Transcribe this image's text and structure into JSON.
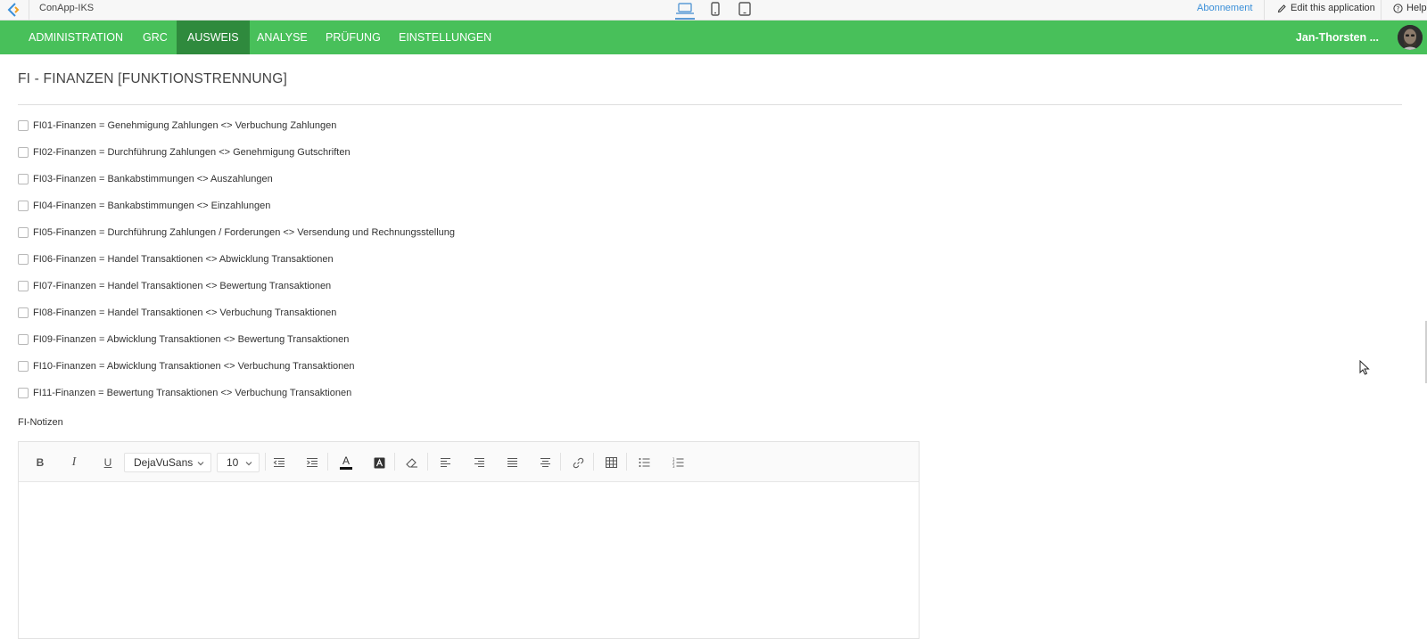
{
  "app": {
    "title": "ConApp-IKS",
    "subscription_link": "Abonnement",
    "edit_link": "Edit this application",
    "help_link": "Help"
  },
  "devices": [
    "desktop-icon",
    "phone-icon",
    "tablet-icon"
  ],
  "nav": {
    "items": [
      "ADMINISTRATION",
      "GRC",
      "AUSWEIS",
      "ANALYSE",
      "PRÜFUNG",
      "EINSTELLUNGEN"
    ],
    "active": "AUSWEIS",
    "user": "Jan-Thorsten ..."
  },
  "page": {
    "title": "FI - FINANZEN [FUNKTIONSTRENNUNG]",
    "checkboxes": [
      "FI01-Finanzen = Genehmigung Zahlungen <> Verbuchung Zahlungen",
      "FI02-Finanzen = Durchführung Zahlungen <> Genehmigung Gutschriften",
      "FI03-Finanzen = Bankabstimmungen <> Auszahlungen",
      "FI04-Finanzen = Bankabstimmungen <> Einzahlungen",
      "FI05-Finanzen = Durchführung Zahlungen / Forderungen <> Versendung und Rechnungsstellung",
      "FI06-Finanzen = Handel Transaktionen <> Abwicklung Transaktionen",
      "FI07-Finanzen = Handel Transaktionen <> Bewertung Transaktionen",
      "FI08-Finanzen = Handel Transaktionen <> Verbuchung Transaktionen",
      "FI09-Finanzen = Abwicklung Transaktionen <> Bewertung Transaktionen",
      "FI10-Finanzen = Abwicklung Transaktionen <> Verbuchung Transaktionen",
      "FI11-Finanzen = Bewertung Transaktionen <> Verbuchung Transaktionen"
    ],
    "notes_label": "FI-Notizen"
  },
  "editor": {
    "bold": "B",
    "italic": "I",
    "underline": "U",
    "font": "DejaVuSans",
    "size": "10",
    "text_color_glyph": "A",
    "content": ""
  },
  "colors": {
    "nav_bg": "#48c05a",
    "nav_active": "#2f8a3d",
    "link": "#3a8fd8"
  }
}
